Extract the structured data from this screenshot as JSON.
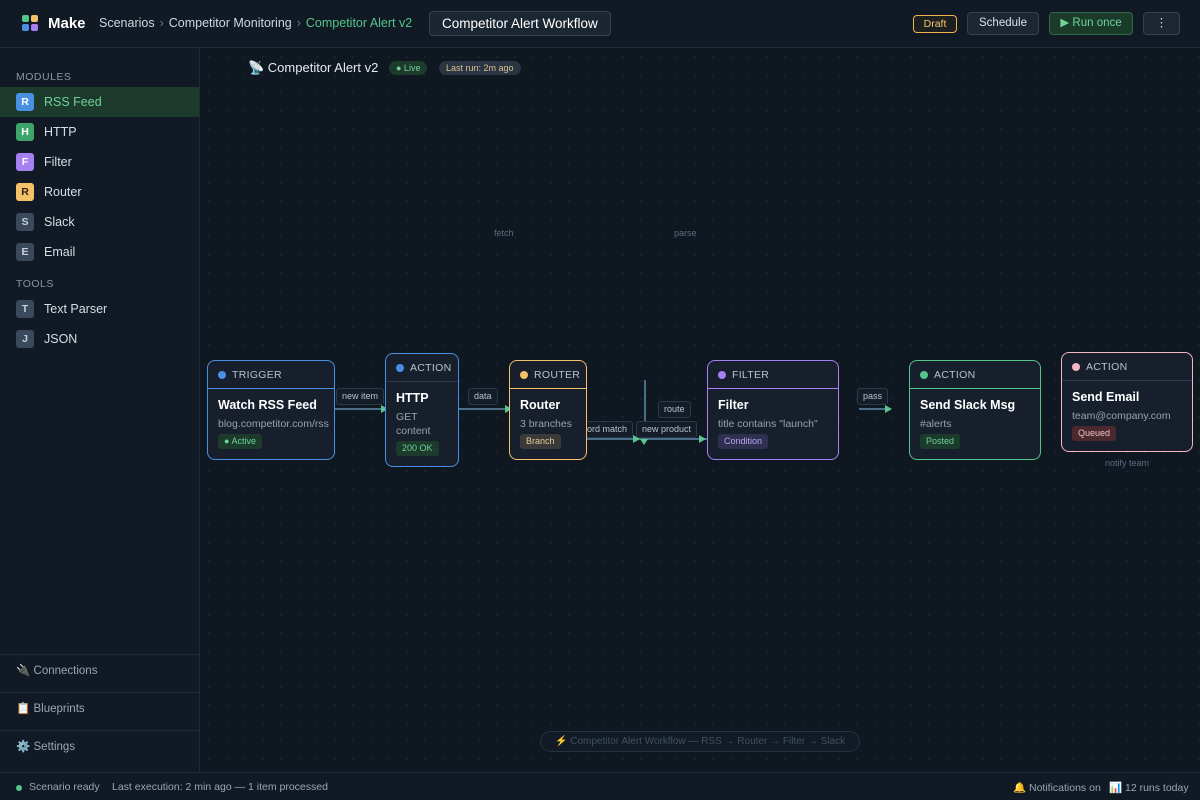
{
  "app": {
    "name": "Make"
  },
  "breadcrumb": {
    "items": [
      "Scenarios",
      "Competitor Monitoring",
      "Competitor Alert v2"
    ],
    "separator": "›"
  },
  "header": {
    "workflow_title": "Competitor Alert Workflow",
    "draft_label": "Draft",
    "schedule_label": "Schedule",
    "run_label": "▶ Run once",
    "more_label": "⋮"
  },
  "sidebar": {
    "modules_heading": "MODULES",
    "modules": [
      {
        "letter": "R",
        "label": "RSS Feed",
        "color": "#4a90e2",
        "active": true
      },
      {
        "letter": "H",
        "label": "HTTP",
        "color": "#3fa46a"
      },
      {
        "letter": "F",
        "label": "Filter",
        "color": "#a77ff0"
      },
      {
        "letter": "R",
        "label": "Router",
        "color": "#f4c06a"
      },
      {
        "letter": "S",
        "label": "Slack",
        "color": "#3a4a5c"
      },
      {
        "letter": "E",
        "label": "Email",
        "color": "#3a4a5c"
      }
    ],
    "tools_heading": "TOOLS",
    "tools": [
      {
        "letter": "T",
        "label": "Text Parser"
      },
      {
        "letter": "J",
        "label": "JSON"
      }
    ],
    "links": [
      "🔌 Connections",
      "📋 Blueprints",
      "⚙️ Settings"
    ]
  },
  "canvas": {
    "scenario_title": "📡 Competitor Alert v2",
    "live_badge": "● Live",
    "last_run_badge": "Last run: 2m ago",
    "flow_labels": {
      "fetch": "fetch",
      "parse": "parse",
      "notify": "notify team"
    },
    "edges": {
      "new_item": "new item",
      "data": "data",
      "keyword_match": "ord match",
      "new_product": "new product",
      "route": "route",
      "pass": "pass"
    },
    "nodes": [
      {
        "type": "TRIGGER",
        "title": "Watch RSS Feed",
        "subtitle": "blog.competitor.com/rss",
        "badge": "● Active",
        "color": "#4a90e2"
      },
      {
        "type": "ACTION",
        "title": "HTTP",
        "subtitle": "GET content",
        "badge": "200 OK",
        "color": "#4a90e2"
      },
      {
        "type": "ROUTER",
        "title": "Router",
        "subtitle": "3 branches",
        "badge": "Branch",
        "color": "#f4c06a"
      },
      {
        "type": "FILTER",
        "title": "Filter",
        "subtitle": "title contains \"launch\"",
        "badge": "Condition",
        "color": "#a77ff0"
      },
      {
        "type": "ACTION",
        "title": "Send Slack Msg",
        "subtitle": "#alerts",
        "badge": "Posted",
        "color": "#54c48a"
      },
      {
        "type": "ACTION",
        "title": "Send Email",
        "subtitle": "team@company.com",
        "badge": "Queued",
        "color": "#f3b6c3"
      }
    ],
    "footer_summary": "⚡ Competitor Alert Workflow — RSS → Router → Filter → Slack"
  },
  "statusbar": {
    "ready": "Scenario ready",
    "last_execution": "Last execution: 2 min ago — 1 item processed",
    "notifications": "🔔 Notifications on",
    "runs": "📊 12 runs today"
  },
  "colors": {
    "accent": "#54c48a",
    "background": "#0f1720",
    "panel": "#111a24"
  }
}
